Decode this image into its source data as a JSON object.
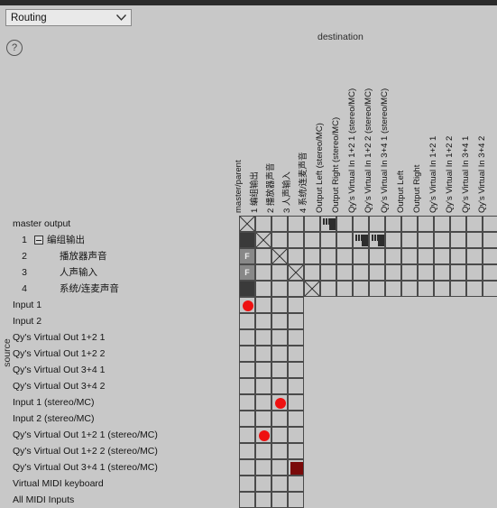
{
  "window": {
    "accent": "#2b2b2b",
    "background": "#c8c8c8"
  },
  "toolbar": {
    "preset_select": {
      "value": "Routing",
      "icon": "chevron-down-icon"
    },
    "help_button": {
      "label": "?"
    }
  },
  "matrix": {
    "destination_label": "destination",
    "source_label": "source",
    "columns": [
      {
        "index": 0,
        "label": "master/parent"
      },
      {
        "index": 1,
        "label": "1  编组输出"
      },
      {
        "index": 2,
        "label": "2  播放器声音"
      },
      {
        "index": 3,
        "label": "3  人声输入"
      },
      {
        "index": 4,
        "label": "4  系统/连麦声音"
      },
      {
        "index": 5,
        "label": "Output Left (stereo/MC)"
      },
      {
        "index": 6,
        "label": "Output Right (stereo/MC)"
      },
      {
        "index": 7,
        "label": "Qy's Virtual In 1+2 1 (stereo/MC)"
      },
      {
        "index": 8,
        "label": "Qy's Virtual In 1+2 2 (stereo/MC)"
      },
      {
        "index": 9,
        "label": "Qy's Virtual In 3+4 1 (stereo/MC)"
      },
      {
        "index": 10,
        "label": "Output Left"
      },
      {
        "index": 11,
        "label": "Output Right"
      },
      {
        "index": 12,
        "label": "Qy's Virtual In 1+2 1"
      },
      {
        "index": 13,
        "label": "Qy's Virtual In 1+2 2"
      },
      {
        "index": 14,
        "label": "Qy's Virtual In 3+4 1"
      },
      {
        "index": 15,
        "label": "Qy's Virtual In 3+4 2"
      }
    ],
    "rows": [
      {
        "index": 0,
        "num": "",
        "label": "master output",
        "indent": 14,
        "expander": false,
        "width": 16
      },
      {
        "index": 1,
        "num": "1",
        "label": "编组输出",
        "indent": 52,
        "expander": true,
        "width": 16
      },
      {
        "index": 2,
        "num": "2",
        "label": "播放器声音",
        "indent": 66,
        "expander": false,
        "width": 16
      },
      {
        "index": 3,
        "num": "3",
        "label": "人声输入",
        "indent": 66,
        "expander": false,
        "width": 16
      },
      {
        "index": 4,
        "num": "4",
        "label": "系统/连麦声音",
        "indent": 66,
        "expander": false,
        "width": 16
      },
      {
        "index": 5,
        "num": "",
        "label": "Input 1",
        "indent": 14,
        "expander": false,
        "width": 4
      },
      {
        "index": 6,
        "num": "",
        "label": "Input 2",
        "indent": 14,
        "expander": false,
        "width": 4
      },
      {
        "index": 7,
        "num": "",
        "label": "Qy's Virtual Out 1+2 1",
        "indent": 14,
        "expander": false,
        "width": 4
      },
      {
        "index": 8,
        "num": "",
        "label": "Qy's Virtual Out 1+2 2",
        "indent": 14,
        "expander": false,
        "width": 4
      },
      {
        "index": 9,
        "num": "",
        "label": "Qy's Virtual Out 3+4 1",
        "indent": 14,
        "expander": false,
        "width": 4
      },
      {
        "index": 10,
        "num": "",
        "label": "Qy's Virtual Out 3+4 2",
        "indent": 14,
        "expander": false,
        "width": 4
      },
      {
        "index": 11,
        "num": "",
        "label": "Input 1 (stereo/MC)",
        "indent": 14,
        "expander": false,
        "width": 4
      },
      {
        "index": 12,
        "num": "",
        "label": "Input 2 (stereo/MC)",
        "indent": 14,
        "expander": false,
        "width": 4
      },
      {
        "index": 13,
        "num": "",
        "label": "Qy's Virtual Out 1+2 1 (stereo/MC)",
        "indent": 14,
        "expander": false,
        "width": 4
      },
      {
        "index": 14,
        "num": "",
        "label": "Qy's Virtual Out 1+2 2 (stereo/MC)",
        "indent": 14,
        "expander": false,
        "width": 4
      },
      {
        "index": 15,
        "num": "",
        "label": "Qy's Virtual Out 3+4 1 (stereo/MC)",
        "indent": 14,
        "expander": false,
        "width": 4
      },
      {
        "index": 16,
        "num": "",
        "label": "Virtual MIDI keyboard",
        "indent": 14,
        "expander": false,
        "width": 4
      },
      {
        "index": 17,
        "num": "",
        "label": "All MIDI Inputs",
        "indent": 14,
        "expander": false,
        "width": 4
      }
    ],
    "cells": [
      {
        "row": 0,
        "col": 0,
        "state": "cross"
      },
      {
        "row": 0,
        "col": 5,
        "state": "midi"
      },
      {
        "row": 1,
        "col": 0,
        "state": "dark"
      },
      {
        "row": 1,
        "col": 1,
        "state": "cross"
      },
      {
        "row": 1,
        "col": 7,
        "state": "midi"
      },
      {
        "row": 1,
        "col": 8,
        "state": "midi"
      },
      {
        "row": 2,
        "col": 0,
        "state": "fader",
        "text": "F"
      },
      {
        "row": 2,
        "col": 2,
        "state": "cross"
      },
      {
        "row": 3,
        "col": 0,
        "state": "fader",
        "text": "F"
      },
      {
        "row": 3,
        "col": 3,
        "state": "cross"
      },
      {
        "row": 4,
        "col": 0,
        "state": "dark"
      },
      {
        "row": 4,
        "col": 4,
        "state": "cross"
      },
      {
        "row": 5,
        "col": 0,
        "state": "on"
      },
      {
        "row": 11,
        "col": 2,
        "state": "on"
      },
      {
        "row": 13,
        "col": 1,
        "state": "on"
      },
      {
        "row": 15,
        "col": 3,
        "state": "dimmed"
      }
    ],
    "colors": {
      "connection_on": "#ee1111",
      "connection_dim": "#7a0a0a",
      "grid_line": "#4a4a4a",
      "cell_fill": "#c6c6c6",
      "cell_dark": "#3a3a3a",
      "cell_fader": "#888888"
    }
  }
}
